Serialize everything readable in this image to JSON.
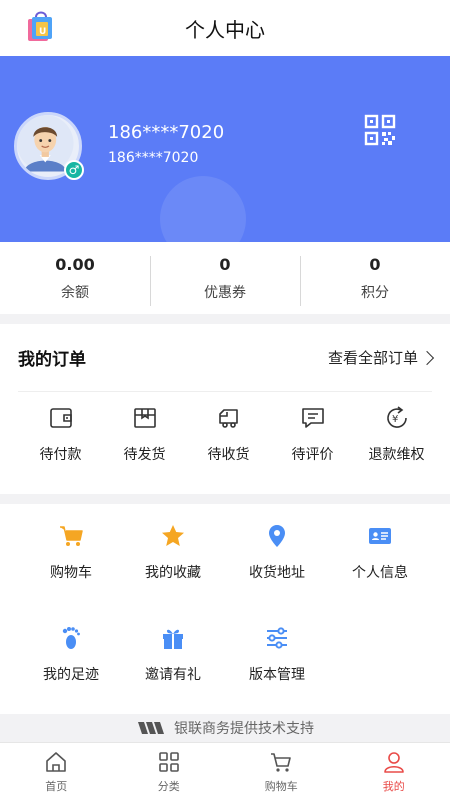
{
  "header": {
    "title": "个人中心"
  },
  "profile": {
    "name": "186****7020",
    "subname": "186****7020",
    "gender_symbol": "♂"
  },
  "stats": [
    {
      "value": "0.00",
      "label": "余额"
    },
    {
      "value": "0",
      "label": "优惠券"
    },
    {
      "value": "0",
      "label": "积分"
    }
  ],
  "orders": {
    "title": "我的订单",
    "view_all": "查看全部订单",
    "items": [
      {
        "label": "待付款",
        "icon": "wallet-icon"
      },
      {
        "label": "待发货",
        "icon": "box-icon"
      },
      {
        "label": "待收货",
        "icon": "truck-icon"
      },
      {
        "label": "待评价",
        "icon": "comment-icon"
      },
      {
        "label": "退款维权",
        "icon": "refund-icon"
      }
    ]
  },
  "tools": [
    {
      "label": "购物车",
      "icon": "cart-icon"
    },
    {
      "label": "我的收藏",
      "icon": "star-icon"
    },
    {
      "label": "收货地址",
      "icon": "location-icon"
    },
    {
      "label": "个人信息",
      "icon": "id-card-icon"
    },
    {
      "label": "我的足迹",
      "icon": "footprint-icon"
    },
    {
      "label": "邀请有礼",
      "icon": "gift-icon"
    },
    {
      "label": "版本管理",
      "icon": "sliders-icon"
    }
  ],
  "footer": {
    "credit": "银联商务提供技术支持"
  },
  "tabbar": [
    {
      "label": "首页",
      "icon": "home-icon"
    },
    {
      "label": "分类",
      "icon": "grid-icon"
    },
    {
      "label": "购物车",
      "icon": "cart-icon"
    },
    {
      "label": "我的",
      "icon": "user-icon",
      "active": true
    }
  ],
  "colors": {
    "banner": "#5b7cf7",
    "accent_orange": "#f5a623",
    "accent_blue": "#4a8ef5",
    "active_tab": "#e94b48"
  }
}
